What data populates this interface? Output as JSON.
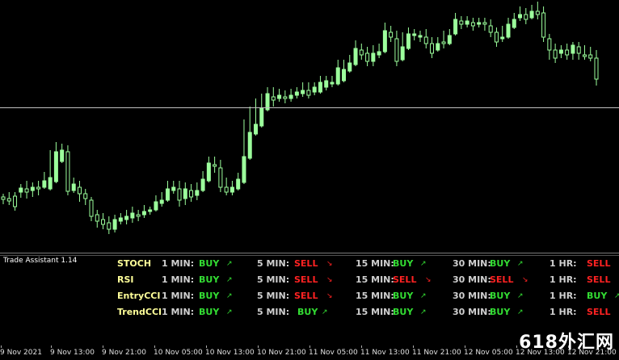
{
  "chart": {
    "price_line_color": "#c0c0c0",
    "candle_color": "#9cff9c",
    "candles": [
      [
        244,
        247,
        251,
        242
      ],
      [
        246,
        249,
        252,
        240
      ],
      [
        243,
        256,
        259,
        240
      ],
      [
        238,
        233,
        243,
        230
      ],
      [
        234,
        238,
        244,
        226
      ],
      [
        236,
        232,
        242,
        228
      ],
      [
        232,
        234,
        240,
        226
      ],
      [
        232,
        224,
        228,
        215
      ],
      [
        234,
        220,
        228,
        188
      ],
      [
        225,
        188,
        192,
        178
      ],
      [
        200,
        186,
        192,
        180
      ],
      [
        188,
        237,
        240,
        182
      ],
      [
        236,
        228,
        237,
        222
      ],
      [
        232,
        240,
        248,
        226
      ],
      [
        240,
        246,
        252,
        236
      ],
      [
        248,
        268,
        272,
        246
      ],
      [
        266,
        274,
        280,
        262
      ],
      [
        272,
        278,
        282,
        266
      ],
      [
        276,
        284,
        288,
        270
      ],
      [
        284,
        272,
        286,
        268
      ],
      [
        274,
        270,
        276,
        266
      ],
      [
        272,
        268,
        276,
        262
      ],
      [
        270,
        264,
        274,
        258
      ],
      [
        266,
        268,
        272,
        262
      ],
      [
        266,
        262,
        268,
        256
      ],
      [
        262,
        260,
        264,
        258
      ],
      [
        260,
        250,
        256,
        244
      ],
      [
        252,
        248,
        254,
        240
      ],
      [
        248,
        234,
        244,
        226
      ],
      [
        236,
        232,
        238,
        226
      ],
      [
        234,
        248,
        254,
        226
      ],
      [
        246,
        234,
        252,
        228
      ],
      [
        236,
        244,
        248,
        230
      ],
      [
        242,
        236,
        246,
        228
      ],
      [
        236,
        222,
        232,
        214
      ],
      [
        224,
        202,
        216,
        196
      ],
      [
        204,
        206,
        212,
        196
      ],
      [
        208,
        232,
        236,
        200
      ],
      [
        232,
        238,
        240,
        222
      ],
      [
        238,
        232,
        240,
        226
      ],
      [
        234,
        222,
        232,
        216
      ],
      [
        226,
        194,
        200,
        150
      ],
      [
        196,
        164,
        168,
        134
      ],
      [
        166,
        154,
        160,
        124
      ],
      [
        156,
        134,
        138,
        118
      ],
      [
        136,
        116,
        120,
        110
      ],
      [
        120,
        124,
        130,
        110
      ],
      [
        122,
        118,
        124,
        112
      ],
      [
        120,
        120,
        126,
        114
      ],
      [
        122,
        118,
        124,
        112
      ],
      [
        118,
        114,
        120,
        110
      ],
      [
        116,
        112,
        118,
        104
      ],
      [
        112,
        118,
        120,
        104
      ],
      [
        114,
        108,
        116,
        104
      ],
      [
        114,
        102,
        112,
        96
      ],
      [
        108,
        100,
        110,
        96
      ],
      [
        104,
        102,
        106,
        96
      ],
      [
        104,
        84,
        96,
        76
      ],
      [
        100,
        86,
        96,
        76
      ],
      [
        88,
        78,
        86,
        70
      ],
      [
        80,
        60,
        68,
        52
      ],
      [
        62,
        68,
        72,
        56
      ],
      [
        66,
        76,
        80,
        60
      ],
      [
        76,
        66,
        80,
        58
      ],
      [
        68,
        64,
        70,
        56
      ],
      [
        64,
        38,
        48,
        30
      ],
      [
        40,
        46,
        50,
        34
      ],
      [
        48,
        76,
        80,
        40
      ],
      [
        74,
        58,
        60,
        42
      ],
      [
        60,
        42,
        48,
        36
      ],
      [
        44,
        42,
        48,
        38
      ],
      [
        46,
        44,
        50,
        40
      ],
      [
        46,
        54,
        58,
        38
      ],
      [
        54,
        66,
        70,
        48
      ],
      [
        62,
        54,
        58,
        48
      ],
      [
        52,
        54,
        58,
        40
      ],
      [
        54,
        44,
        50,
        38
      ],
      [
        42,
        24,
        34,
        18
      ],
      [
        26,
        30,
        34,
        22
      ],
      [
        30,
        26,
        32,
        22
      ],
      [
        28,
        32,
        36,
        24
      ],
      [
        30,
        28,
        32,
        24
      ],
      [
        28,
        30,
        36,
        24
      ],
      [
        32,
        40,
        44,
        26
      ],
      [
        40,
        52,
        56,
        36
      ],
      [
        48,
        46,
        50,
        34
      ],
      [
        46,
        30,
        34,
        24
      ],
      [
        34,
        24,
        30,
        18
      ],
      [
        22,
        18,
        24,
        10
      ],
      [
        18,
        24,
        28,
        12
      ],
      [
        22,
        14,
        20,
        8
      ],
      [
        14,
        18,
        22,
        4
      ],
      [
        16,
        46,
        50,
        10
      ],
      [
        48,
        62,
        72,
        44
      ],
      [
        62,
        72,
        76,
        56
      ],
      [
        66,
        62,
        70,
        58
      ],
      [
        62,
        68,
        72,
        56
      ],
      [
        66,
        56,
        72,
        54
      ],
      [
        58,
        66,
        72,
        54
      ],
      [
        68,
        68,
        72,
        58
      ],
      [
        68,
        72,
        74,
        60
      ],
      [
        72,
        98,
        104,
        64
      ]
    ],
    "price_line_level": 0.425
  },
  "indicator": {
    "title": "Trade Assistant 1.14",
    "timeframes": [
      "1 MIN:",
      "5 MIN:",
      "15 MIN:",
      "30 MIN:",
      "1 HR:"
    ],
    "rows": [
      {
        "name": "STOCH",
        "signals": [
          "BUY",
          "SELL",
          "BUY",
          "BUY",
          "SELL"
        ]
      },
      {
        "name": "RSI",
        "signals": [
          "BUY",
          "SELL",
          "SELL",
          "SELL",
          "SELL"
        ]
      },
      {
        "name": "EntryCCI",
        "signals": [
          "BUY",
          "SELL",
          "BUY",
          "BUY",
          "BUY"
        ]
      },
      {
        "name": "TrendCCI",
        "signals": [
          "BUY",
          "BUY",
          "BUY",
          "BUY",
          "SELL"
        ]
      }
    ],
    "buy_color": "#33dd33",
    "sell_color": "#ff2222",
    "buy_arrow": "↗",
    "sell_arrow": "↘"
  },
  "xaxis": {
    "labels": [
      "9 Nov 2021",
      "9 Nov 13:00",
      "9 Nov 21:00",
      "10 Nov 05:00",
      "10 Nov 13:00",
      "10 Nov 21:00",
      "11 Nov 05:00",
      "11 Nov 13:00",
      "11 Nov 21:00",
      "12 Nov 05:00",
      "12 Nov 13:00",
      "12 Nov 21:00"
    ]
  },
  "watermark": "618外汇网"
}
